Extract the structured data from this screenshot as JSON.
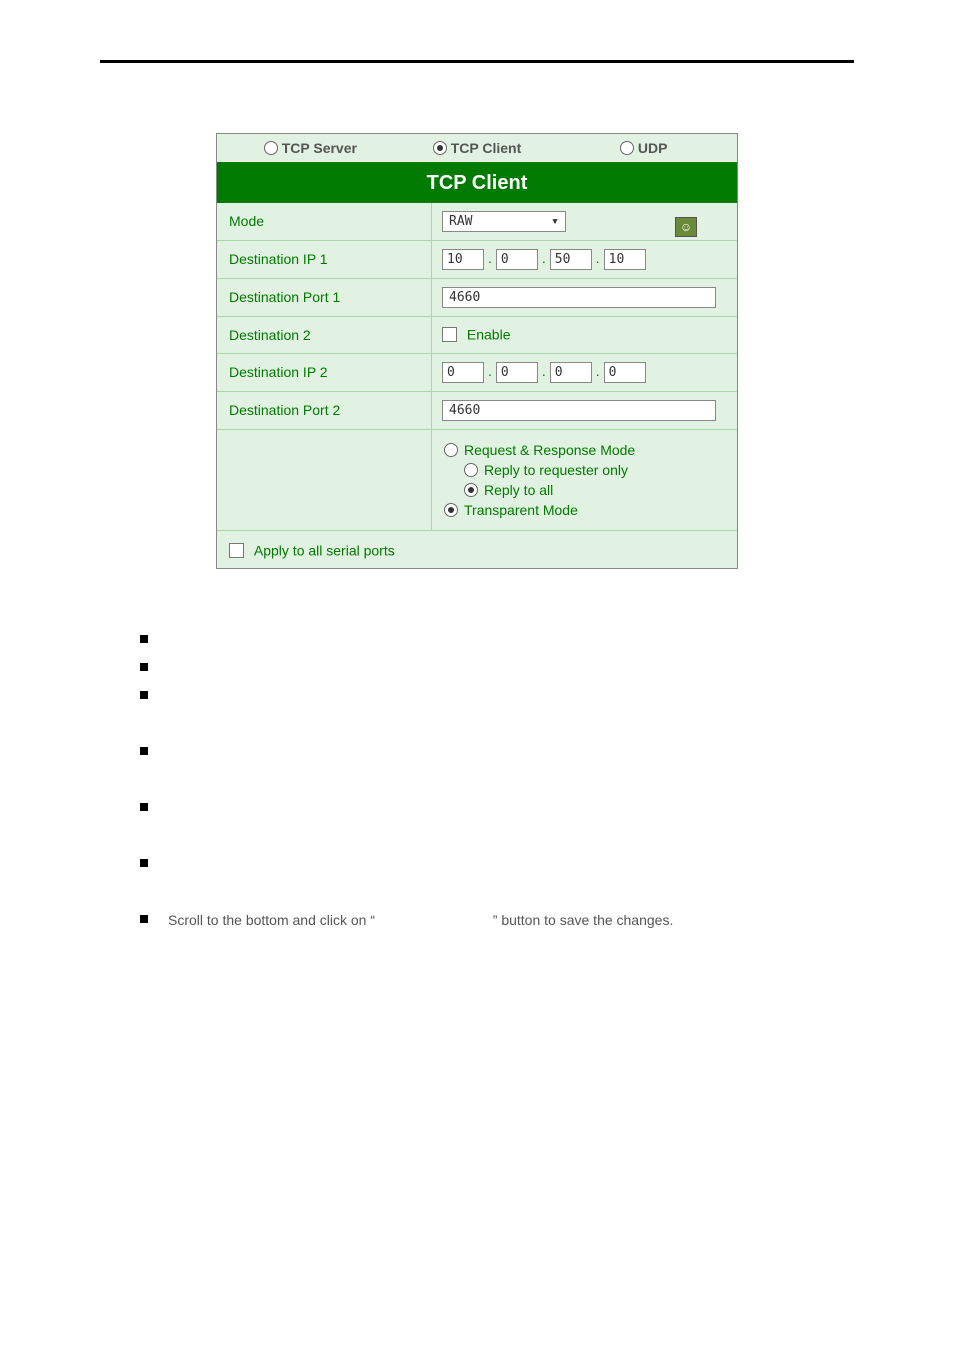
{
  "tabs": {
    "tcp_server": "TCP Server",
    "tcp_client": "TCP Client",
    "udp": "UDP"
  },
  "panel_title": "TCP Client",
  "rows": {
    "mode_label": "Mode",
    "mode_value": "RAW",
    "dest_ip1_label": "Destination IP 1",
    "dest_ip1": {
      "o1": "10",
      "o2": "0",
      "o3": "50",
      "o4": "10"
    },
    "dest_port1_label": "Destination Port 1",
    "dest_port1_value": "4660",
    "dest2_label": "Destination 2",
    "dest2_enable": "Enable",
    "dest_ip2_label": "Destination IP 2",
    "dest_ip2": {
      "o1": "0",
      "o2": "0",
      "o3": "0",
      "o4": "0"
    },
    "dest_port2_label": "Destination Port 2",
    "dest_port2_value": "4660",
    "opt_req_resp": "Request & Response Mode",
    "opt_req_only": "Reply to requester only",
    "opt_reply_all": "Reply to all",
    "opt_transparent": "Transparent Mode",
    "apply_all": "Apply to all serial ports"
  },
  "instruction": {
    "prefix": "Scroll to the bottom and click on “",
    "suffix": "” button to save the changes."
  }
}
